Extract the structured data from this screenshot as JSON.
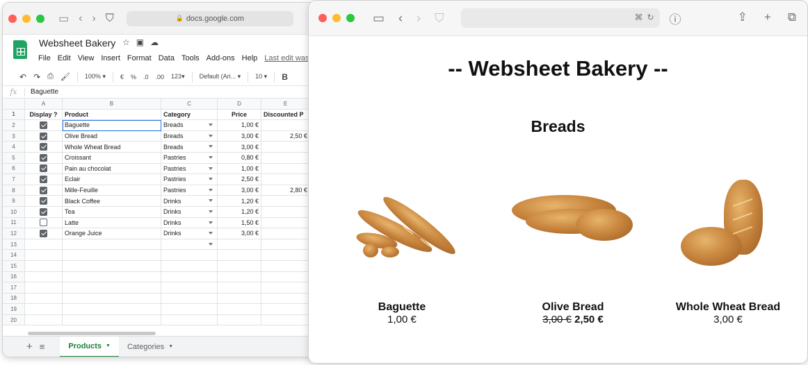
{
  "sheets": {
    "address": "docs.google.com",
    "doc_title": "Websheet Bakery",
    "menu": [
      "File",
      "Edit",
      "View",
      "Insert",
      "Format",
      "Data",
      "Tools",
      "Add-ons",
      "Help"
    ],
    "last_edit": "Last edit was",
    "toolbar": {
      "zoom": "100%",
      "currency": "€",
      "percent": "%",
      "dec_less": ".0",
      "dec_more": ".00",
      "number_format": "123",
      "font": "Default (Ari...",
      "font_size": "10",
      "bold": "B"
    },
    "formula_bar": {
      "fx": "fx",
      "value": "Baguette"
    },
    "columns": [
      "A",
      "B",
      "C",
      "D",
      "E"
    ],
    "headers": [
      "Display ?",
      "Product",
      "Category",
      "Price",
      "Discounted P"
    ],
    "rows": [
      {
        "n": "2",
        "display": true,
        "product": "Baguette",
        "category": "Breads",
        "price": "1,00 €",
        "discounted": ""
      },
      {
        "n": "3",
        "display": true,
        "product": "Olive Bread",
        "category": "Breads",
        "price": "3,00 €",
        "discounted": "2,50 €"
      },
      {
        "n": "4",
        "display": true,
        "product": "Whole Wheat Bread",
        "category": "Breads",
        "price": "3,00 €",
        "discounted": ""
      },
      {
        "n": "5",
        "display": true,
        "product": "Croissant",
        "category": "Pastries",
        "price": "0,80 €",
        "discounted": ""
      },
      {
        "n": "6",
        "display": true,
        "product": "Pain au chocolat",
        "category": "Pastries",
        "price": "1,00 €",
        "discounted": ""
      },
      {
        "n": "7",
        "display": true,
        "product": "Eclair",
        "category": "Pastries",
        "price": "2,50 €",
        "discounted": ""
      },
      {
        "n": "8",
        "display": true,
        "product": "Mille-Feuille",
        "category": "Pastries",
        "price": "3,00 €",
        "discounted": "2,80 €"
      },
      {
        "n": "9",
        "display": true,
        "product": "Black Coffee",
        "category": "Drinks",
        "price": "1,20 €",
        "discounted": ""
      },
      {
        "n": "10",
        "display": true,
        "product": "Tea",
        "category": "Drinks",
        "price": "1,20 €",
        "discounted": ""
      },
      {
        "n": "11",
        "display": false,
        "product": "Latte",
        "category": "Drinks",
        "price": "1,50 €",
        "discounted": ""
      },
      {
        "n": "12",
        "display": true,
        "product": "Orange Juice",
        "category": "Drinks",
        "price": "3,00 €",
        "discounted": ""
      }
    ],
    "empty_rows": [
      "13",
      "14",
      "15",
      "16",
      "17",
      "18",
      "19",
      "20"
    ],
    "header_row_num": "1",
    "tabs": {
      "active": "Products",
      "other": "Categories"
    }
  },
  "site": {
    "title": "-- Websheet Bakery --",
    "section": "Breads",
    "products": [
      {
        "name": "Baguette",
        "price": "1,00 €"
      },
      {
        "name": "Olive Bread",
        "old_price": "3,00 €",
        "new_price": "2,50 €"
      },
      {
        "name": "Whole Wheat Bread",
        "price": "3,00 €"
      }
    ]
  }
}
